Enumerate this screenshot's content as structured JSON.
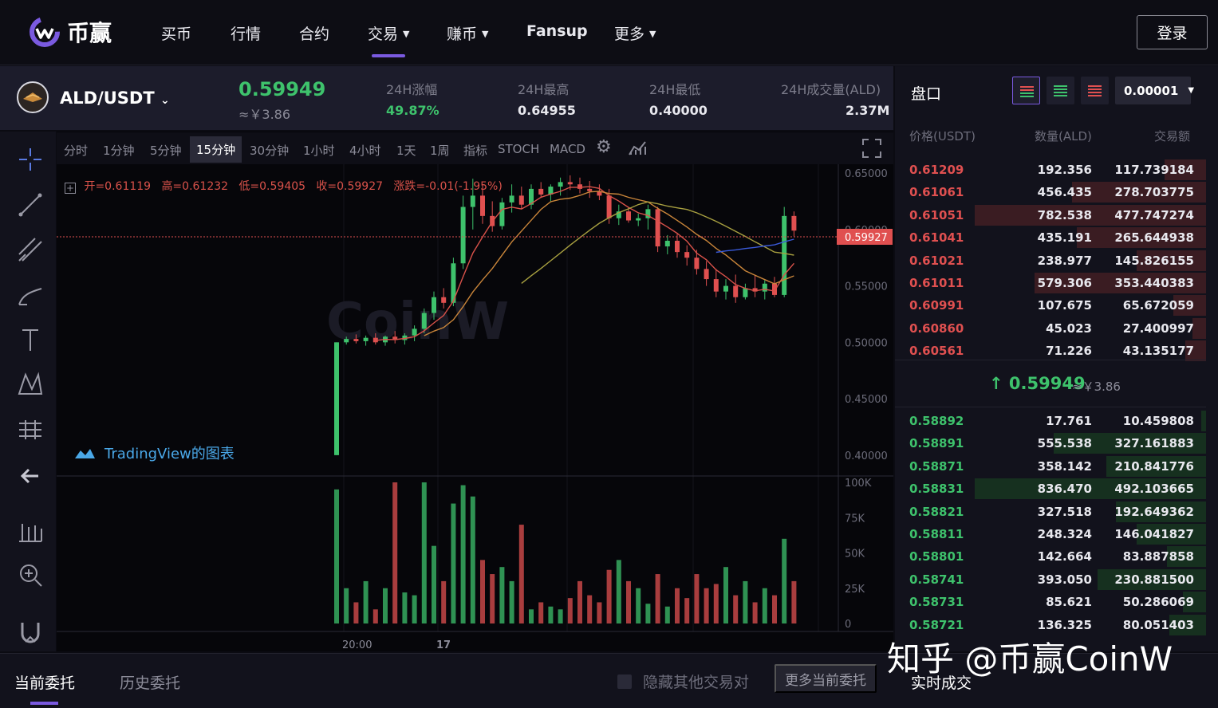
{
  "nav": {
    "logo_text": "币赢",
    "items": [
      "买币",
      "行情",
      "合约",
      "交易",
      "赚币",
      "Fansup",
      "更多"
    ],
    "login": "登录"
  },
  "ticker": {
    "pair": "ALD/USDT",
    "price": "0.59949",
    "price_cny": "≈￥3.86",
    "change_label": "24H涨幅",
    "change_val": "49.87%",
    "high_label": "24H最高",
    "high_val": "0.64955",
    "low_label": "24H最低",
    "low_val": "0.40000",
    "vol_label": "24H成交量(ALD)",
    "vol_val": "2.37M"
  },
  "intervals": [
    "分时",
    "1分钟",
    "5分钟",
    "15分钟",
    "30分钟",
    "1小时",
    "4小时",
    "1天",
    "1周",
    "指标",
    "STOCH",
    "MACD"
  ],
  "active_interval": "15分钟",
  "ohlc": {
    "open": "开=0.61119",
    "high": "高=0.61232",
    "low": "低=0.59405",
    "close": "收=0.59927",
    "change": "涨跌=-0.01(-1.95%)"
  },
  "chart": {
    "price_axis": [
      "0.65000",
      "0.60000",
      "0.55000",
      "0.50000",
      "0.45000",
      "0.40000"
    ],
    "current_price_tag": "0.59927",
    "volume_axis": [
      "100K",
      "75K",
      "50K",
      "25K",
      "0"
    ],
    "time_axis": [
      "20:00",
      "17"
    ],
    "tv_label": "TradingView的图表",
    "brand_watermark": "CoinW",
    "colors": {
      "up": "#3ec26c",
      "down": "#e05050",
      "ma1": "#d9524a",
      "ma2": "#c9853a",
      "ma3": "#a8a040",
      "ma4": "#3a5ad9"
    }
  },
  "chart_data": {
    "type": "candlestick",
    "candles": [
      [
        0.4,
        0.5,
        0.4,
        0.5
      ],
      [
        0.5,
        0.505,
        0.498,
        0.503
      ],
      [
        0.503,
        0.507,
        0.499,
        0.501
      ],
      [
        0.501,
        0.506,
        0.497,
        0.504
      ],
      [
        0.504,
        0.508,
        0.498,
        0.5
      ],
      [
        0.5,
        0.506,
        0.497,
        0.505
      ],
      [
        0.505,
        0.51,
        0.499,
        0.502
      ],
      [
        0.502,
        0.508,
        0.498,
        0.506
      ],
      [
        0.506,
        0.515,
        0.501,
        0.512
      ],
      [
        0.512,
        0.53,
        0.508,
        0.526
      ],
      [
        0.526,
        0.545,
        0.52,
        0.54
      ],
      [
        0.54,
        0.548,
        0.53,
        0.535
      ],
      [
        0.535,
        0.575,
        0.532,
        0.57
      ],
      [
        0.57,
        0.63,
        0.565,
        0.62
      ],
      [
        0.62,
        0.645,
        0.6,
        0.63
      ],
      [
        0.63,
        0.64,
        0.605,
        0.612
      ],
      [
        0.612,
        0.625,
        0.598,
        0.603
      ],
      [
        0.603,
        0.628,
        0.6,
        0.624
      ],
      [
        0.624,
        0.64,
        0.615,
        0.63
      ],
      [
        0.63,
        0.638,
        0.618,
        0.622
      ],
      [
        0.622,
        0.64,
        0.618,
        0.636
      ],
      [
        0.636,
        0.642,
        0.628,
        0.631
      ],
      [
        0.631,
        0.64,
        0.625,
        0.638
      ],
      [
        0.638,
        0.646,
        0.63,
        0.642
      ],
      [
        0.642,
        0.648,
        0.635,
        0.64
      ],
      [
        0.64,
        0.646,
        0.632,
        0.636
      ],
      [
        0.636,
        0.643,
        0.628,
        0.634
      ],
      [
        0.634,
        0.64,
        0.626,
        0.63
      ],
      [
        0.63,
        0.636,
        0.605,
        0.61
      ],
      [
        0.61,
        0.622,
        0.604,
        0.616
      ],
      [
        0.616,
        0.62,
        0.606,
        0.608
      ],
      [
        0.608,
        0.614,
        0.603,
        0.61
      ],
      [
        0.61,
        0.622,
        0.6,
        0.618
      ],
      [
        0.618,
        0.62,
        0.58,
        0.585
      ],
      [
        0.585,
        0.595,
        0.578,
        0.59
      ],
      [
        0.59,
        0.596,
        0.575,
        0.58
      ],
      [
        0.58,
        0.586,
        0.568,
        0.575
      ],
      [
        0.575,
        0.582,
        0.56,
        0.565
      ],
      [
        0.565,
        0.572,
        0.55,
        0.556
      ],
      [
        0.556,
        0.565,
        0.54,
        0.545
      ],
      [
        0.545,
        0.556,
        0.538,
        0.55
      ],
      [
        0.55,
        0.56,
        0.535,
        0.54
      ],
      [
        0.54,
        0.552,
        0.538,
        0.548
      ],
      [
        0.548,
        0.56,
        0.54,
        0.545
      ],
      [
        0.545,
        0.555,
        0.538,
        0.552
      ],
      [
        0.552,
        0.558,
        0.54,
        0.542
      ],
      [
        0.542,
        0.62,
        0.54,
        0.612
      ],
      [
        0.612,
        0.616,
        0.594,
        0.599
      ]
    ],
    "volumes": [
      95,
      25,
      15,
      30,
      10,
      25,
      100,
      22,
      20,
      100,
      55,
      30,
      85,
      98,
      90,
      45,
      35,
      40,
      30,
      70,
      10,
      15,
      12,
      10,
      18,
      30,
      20,
      15,
      38,
      45,
      30,
      25,
      14,
      35,
      12,
      25,
      18,
      35,
      25,
      28,
      40,
      20,
      30,
      15,
      25,
      20,
      60,
      30
    ],
    "price_range": [
      0.39,
      0.655
    ],
    "volume_range": [
      0,
      100
    ]
  },
  "orderbook": {
    "title": "盘口",
    "precision": "0.00001",
    "headers": [
      "价格(USDT)",
      "数量(ALD)",
      "交易额"
    ],
    "asks": [
      [
        "0.61209",
        "192.356",
        "117.739184",
        0.18
      ],
      [
        "0.61061",
        "456.435",
        "278.703775",
        0.58
      ],
      [
        "0.61051",
        "782.538",
        "477.747274",
        1.0
      ],
      [
        "0.61041",
        "435.191",
        "265.644938",
        0.56
      ],
      [
        "0.61021",
        "238.977",
        "145.826155",
        0.3
      ],
      [
        "0.61011",
        "579.306",
        "353.440383",
        0.74
      ],
      [
        "0.60991",
        "107.675",
        "65.672059",
        0.14
      ],
      [
        "0.60860",
        "45.023",
        "27.400997",
        0.06
      ],
      [
        "0.60561",
        "71.226",
        "43.135177",
        0.09
      ]
    ],
    "mid_price": "↑ 0.59949",
    "mid_cny": "≈￥3.86",
    "bids": [
      [
        "0.58892",
        "17.761",
        "10.459808",
        0.02
      ],
      [
        "0.58891",
        "555.538",
        "327.161883",
        0.66
      ],
      [
        "0.58871",
        "358.142",
        "210.841776",
        0.43
      ],
      [
        "0.58831",
        "836.470",
        "492.103665",
        1.0
      ],
      [
        "0.58821",
        "327.518",
        "192.649362",
        0.39
      ],
      [
        "0.58811",
        "248.324",
        "146.041827",
        0.3
      ],
      [
        "0.58801",
        "142.664",
        "83.887858",
        0.17
      ],
      [
        "0.58741",
        "393.050",
        "230.881500",
        0.47
      ],
      [
        "0.58731",
        "85.621",
        "50.286069",
        0.1
      ],
      [
        "0.58721",
        "136.325",
        "80.051403",
        0.16
      ]
    ]
  },
  "bottom": {
    "tab_current": "当前委托",
    "tab_history": "历史委托",
    "hide_label": "隐藏其他交易对",
    "more_btn": "更多当前委托",
    "trades_tab": "实时成交",
    "watermark": "知乎 @币赢CoinW"
  }
}
